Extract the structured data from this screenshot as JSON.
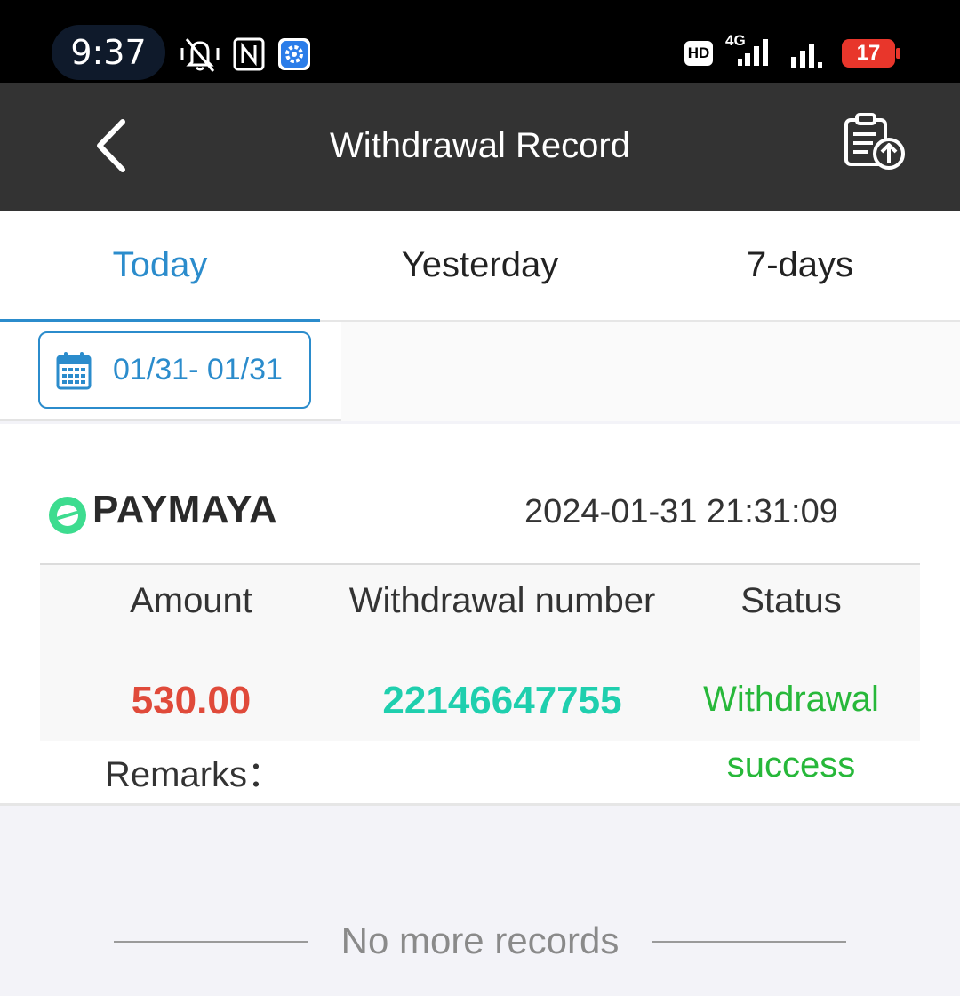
{
  "status_bar": {
    "time": "9:37",
    "icons": [
      "vibrate-silent-icon",
      "nfc-icon",
      "settings-gear-icon",
      "hd-icon",
      "signal-4g-icon",
      "signal-icon",
      "battery-icon"
    ],
    "hd_label": "HD",
    "network_label": "4G",
    "battery_level": "17",
    "battery_color": "#e8362b"
  },
  "header": {
    "title": "Withdrawal Record",
    "back_icon": "chevron-left-icon",
    "action_icon": "clipboard-upload-icon",
    "background": "#333333"
  },
  "tabs": [
    {
      "label": "Today",
      "active": true
    },
    {
      "label": "Yesterday",
      "active": false
    },
    {
      "label": "7-days",
      "active": false
    }
  ],
  "accent_color": "#2b8ccc",
  "date_filter": {
    "icon": "calendar-icon",
    "range": "01/31- 01/31"
  },
  "record": {
    "channel": "PAYMAYA",
    "channel_icon": "paymaya-logo-icon",
    "datetime": "2024-01-31 21:31:09",
    "columns": {
      "amount": "Amount",
      "number": "Withdrawal number",
      "status": "Status"
    },
    "amount": "530.00",
    "amount_color": "#e04a3a",
    "withdrawal_number": "22146647755",
    "number_color": "#1fcfae",
    "status_line1": "Withdrawal",
    "status_line2": "success",
    "status_color": "#27b83a",
    "remarks_label": "Remarks："
  },
  "footer": {
    "no_more": "No more records"
  }
}
